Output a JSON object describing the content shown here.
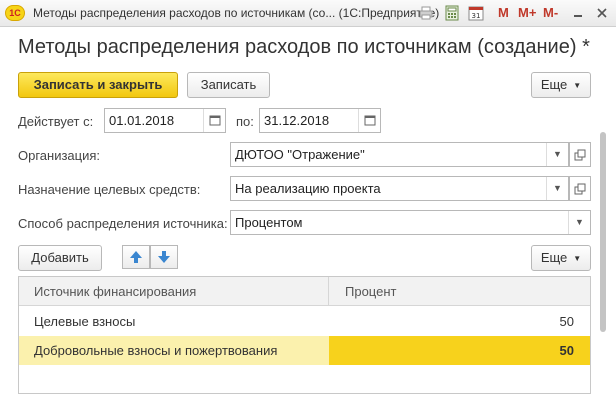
{
  "window": {
    "logo_text": "1С",
    "title": "Методы распределения расходов по источникам (со...  (1С:Предприятие)",
    "tools": [
      "M",
      "M+",
      "M-"
    ]
  },
  "header": {
    "title": "Методы распределения расходов по источникам (создание) *"
  },
  "toolbar": {
    "save_close_label": "Записать и закрыть",
    "save_label": "Записать",
    "more_label": "Еще"
  },
  "form": {
    "valid_from_label": "Действует с:",
    "valid_from_value": "01.01.2018",
    "valid_to_label": "по:",
    "valid_to_value": "31.12.2018",
    "organization_label": "Организация:",
    "organization_value": "ДЮТОО \"Отражение\"",
    "purpose_label": "Назначение целевых средств:",
    "purpose_value": "На реализацию проекта",
    "method_label": "Способ распределения источника:",
    "method_value": "Процентом"
  },
  "table_toolbar": {
    "add_label": "Добавить",
    "more_label": "Еще"
  },
  "table": {
    "columns": [
      "Источник финансирования",
      "Процент"
    ],
    "rows": [
      {
        "source": "Целевые взносы",
        "percent": "50"
      },
      {
        "source": "Добровольные взносы и пожертвования",
        "percent": "50",
        "selected": true
      }
    ]
  },
  "colors": {
    "accent": "#f2c70f",
    "selected_row": "#fbf1ad",
    "selected_cell": "#f7d21c"
  }
}
